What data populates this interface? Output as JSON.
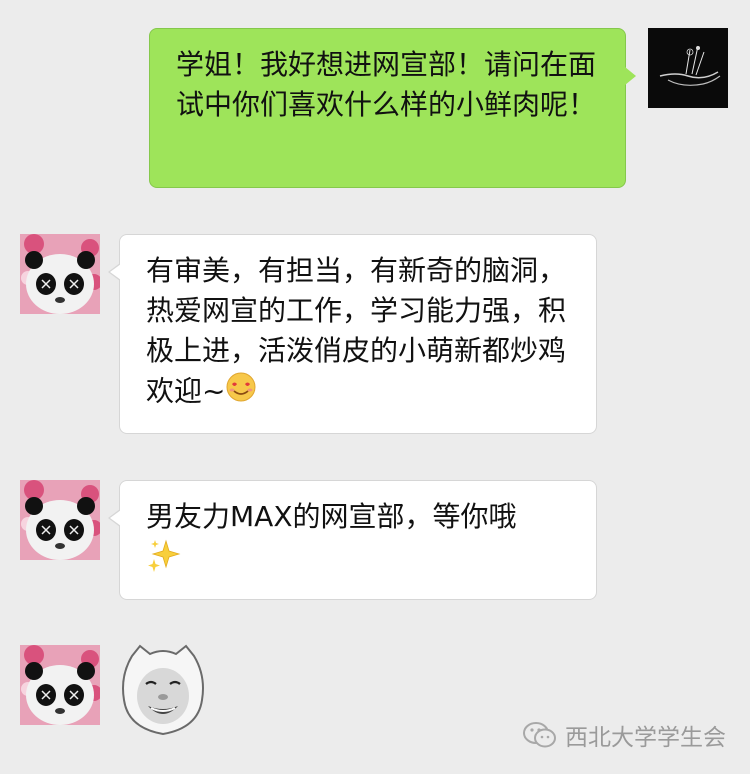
{
  "chat": {
    "messages": [
      {
        "sender": "self",
        "text": "学姐！我好想进网宣部！请问在面试中你们喜欢什么样的小鲜肉呢！"
      },
      {
        "sender": "senior",
        "text": "有审美，有担当，有新奇的脑洞，热爱网宣的工作，学习能力强，积极上进，活泼俏皮的小萌新都炒鸡欢迎~",
        "emoji": "smiling-heart-eyes-emoji"
      },
      {
        "sender": "senior",
        "text": "男友力MAX的网宣部，等你哦",
        "emoji": "sparkles-emoji"
      },
      {
        "sender": "senior",
        "sticker": "laughing-face-sticker"
      }
    ]
  },
  "watermark": {
    "text": "西北大学学生会",
    "icon": "wechat-icon"
  },
  "colors": {
    "background": "#ececec",
    "outgoing_bubble": "#9ee45a",
    "incoming_bubble": "#ffffff"
  }
}
